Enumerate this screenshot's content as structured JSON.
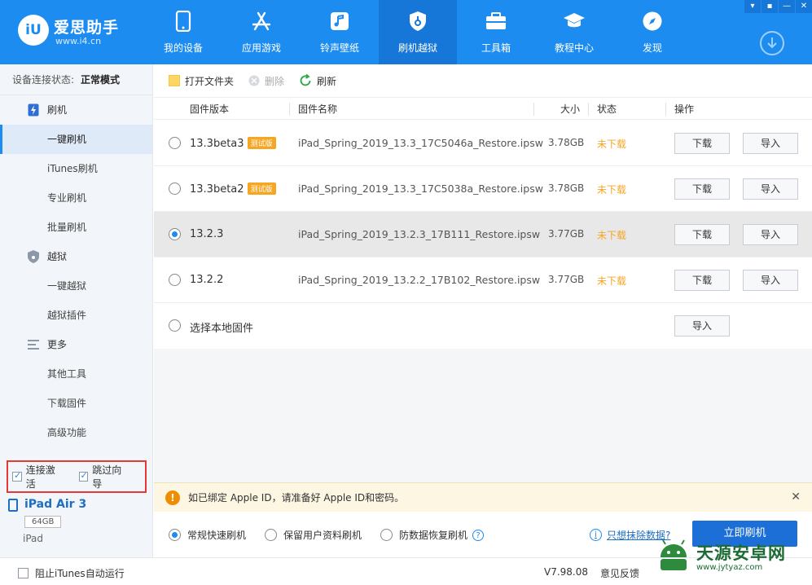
{
  "app": {
    "brand": "爱思助手",
    "url": "www.i4.cn",
    "logo_text": "iU"
  },
  "nav": [
    {
      "label": "我的设备",
      "icon": "phone-icon"
    },
    {
      "label": "应用游戏",
      "icon": "appstore-icon"
    },
    {
      "label": "铃声壁纸",
      "icon": "music-icon"
    },
    {
      "label": "刷机越狱",
      "icon": "flash-shield-icon",
      "active": true
    },
    {
      "label": "工具箱",
      "icon": "toolbox-icon"
    },
    {
      "label": "教程中心",
      "icon": "graduation-cap-icon"
    },
    {
      "label": "发现",
      "icon": "compass-icon"
    }
  ],
  "window_buttons": [
    "▾",
    "▪",
    "—",
    "✕"
  ],
  "sidebar": {
    "status_label": "设备连接状态:",
    "status_value": "正常模式",
    "groups": [
      {
        "label": "刷机",
        "icon": "flash-icon",
        "items": [
          "一键刷机",
          "iTunes刷机",
          "专业刷机",
          "批量刷机"
        ]
      },
      {
        "label": "越狱",
        "icon": "shield-icon",
        "items": [
          "一键越狱",
          "越狱插件"
        ]
      },
      {
        "label": "更多",
        "icon": "menu-icon",
        "items": [
          "其他工具",
          "下载固件",
          "高级功能"
        ]
      }
    ],
    "active_item": "一键刷机",
    "checkboxes": [
      {
        "label": "连接激活",
        "checked": true
      },
      {
        "label": "跳过向导",
        "checked": true
      }
    ],
    "device": {
      "name": "iPad Air 3",
      "capacity": "64GB",
      "type": "iPad"
    }
  },
  "toolbar": {
    "open_folder": "打开文件夹",
    "delete": "删除",
    "refresh": "刷新"
  },
  "table": {
    "headers": {
      "version": "固件版本",
      "name": "固件名称",
      "size": "大小",
      "status": "状态",
      "action": "操作"
    },
    "rows": [
      {
        "version": "13.3beta3",
        "beta": "测试版",
        "name": "iPad_Spring_2019_13.3_17C5046a_Restore.ipsw",
        "size": "3.78GB",
        "status": "未下载",
        "selected": false
      },
      {
        "version": "13.3beta2",
        "beta": "测试版",
        "name": "iPad_Spring_2019_13.3_17C5038a_Restore.ipsw",
        "size": "3.78GB",
        "status": "未下载",
        "selected": false
      },
      {
        "version": "13.2.3",
        "beta": "",
        "name": "iPad_Spring_2019_13.2.3_17B111_Restore.ipsw",
        "size": "3.77GB",
        "status": "未下载",
        "selected": true
      },
      {
        "version": "13.2.2",
        "beta": "",
        "name": "iPad_Spring_2019_13.2.2_17B102_Restore.ipsw",
        "size": "3.77GB",
        "status": "未下载",
        "selected": false
      }
    ],
    "download_label": "下载",
    "import_label": "导入",
    "local_label": "选择本地固件"
  },
  "notice": {
    "text": "如已绑定 Apple ID，请准备好 Apple ID和密码。",
    "close": "✕",
    "icon_text": "!"
  },
  "modes": {
    "options": [
      "常规快速刷机",
      "保留用户资料刷机",
      "防数据恢复刷机"
    ],
    "selected": 0,
    "help": "?",
    "erase_icon_text": "i",
    "erase_link": "只想抹除数据?",
    "flash_button": "立即刷机"
  },
  "footer": {
    "block_itunes": "阻止iTunes自动运行",
    "version": "V7.98.08",
    "feedback": "意见反馈"
  },
  "watermark": {
    "title": "天源安卓网",
    "url": "www.jytyaz.com"
  },
  "colors": {
    "primary": "#1d8cf0",
    "active_nav": "#1677d8",
    "warning": "#f5a623",
    "highlight_border": "#e53935"
  }
}
